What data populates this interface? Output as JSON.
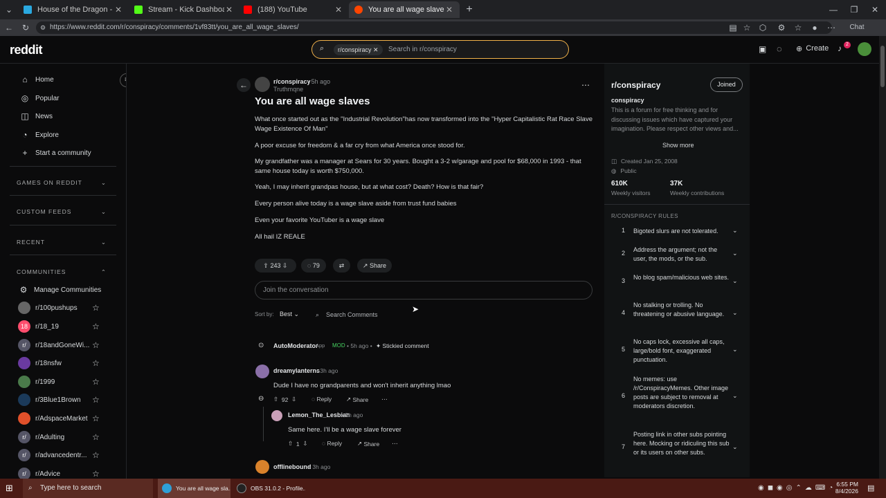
{
  "browser": {
    "tabs": [
      {
        "title": "House of the Dragon - Fmovies",
        "color": "#2aa9e0"
      },
      {
        "title": "Stream - Kick Dashboard",
        "color": "#53fc18"
      },
      {
        "title": "(188) YouTube",
        "color": "#ff0000"
      },
      {
        "title": "You are all wage slaves : r/conspi",
        "color": "#ff4500"
      }
    ],
    "url": "https://www.reddit.com/r/conspiracy/comments/1vf83tt/you_are_all_wage_slaves/",
    "chat_label": "Chat"
  },
  "reddit": {
    "logo": "reddit",
    "search_chip": "r/conspiracy",
    "search_placeholder": "Search in r/conspiracy",
    "create_label": "Create",
    "notif_count": "2"
  },
  "leftnav": {
    "items": [
      "Home",
      "Popular",
      "News",
      "Explore",
      "Start a community"
    ],
    "sections": [
      "GAMES ON REDDIT",
      "CUSTOM FEEDS",
      "RECENT",
      "COMMUNITIES"
    ],
    "manage": "Manage Communities",
    "communities": [
      "r/100pushups",
      "r/18_19",
      "r/18andGoneWi...",
      "r/18nsfw",
      "r/1999",
      "r/3Blue1Brown",
      "r/AdspaceMarket",
      "r/Adulting",
      "r/advancedentr...",
      "r/Advice"
    ]
  },
  "post": {
    "subreddit": "r/conspiracy",
    "age": "• 5h ago",
    "author": "Truthmqne",
    "title": "You are all wage slaves",
    "paragraphs": [
      "What once started out as the \"Industrial Revolution\"has now transformed into the \"Hyper Capitalistic Rat Race Slave Wage Existence Of Man\"",
      "A poor excuse for freedom & a far cry from what America once stood for.",
      "My grandfather was a manager at Sears for 30 years. Bought a 3-2 w/garage and pool for $68,000 in 1993 - that same house today is worth $750,000.",
      "Yeah, I may inherit grandpas house, but at what cost? Death? How is that fair?",
      "Every person alive today is a wage slave aside from trust fund babies",
      "Even your favorite YouTuber is a wage slave",
      "All hail IZ REALE"
    ],
    "votes": "243",
    "comments": "79",
    "share": "Share",
    "join_placeholder": "Join the conversation",
    "sort_label": "Sort by:",
    "sort_value": "Best",
    "search_comments": "Search Comments"
  },
  "comments": [
    {
      "user": "AutoModerator",
      "meta": "App",
      "mod": "MOD",
      "age": "• 5h ago •",
      "sticky": "Stickied comment"
    },
    {
      "user": "dreamylanterns",
      "age": "• 3h ago",
      "text": "Dude I have no grandparents and won't inherit anything lmao",
      "votes": "92",
      "reply": "Reply",
      "share": "Share"
    },
    {
      "user": "Lemon_The_Lesbian",
      "age": "• 2h ago",
      "text": "Same here. I'll be a wage slave forever",
      "votes": "1",
      "reply": "Reply",
      "share": "Share"
    },
    {
      "user": "offlinebound",
      "age": "• 3h ago"
    }
  ],
  "sidebar": {
    "name": "r/conspiracy",
    "joined": "Joined",
    "subtitle": "conspiracy",
    "description": "This is a forum for free thinking and for discussing issues which have captured your imagination. Please respect other views and...",
    "show_more": "Show more",
    "created": "Created Jan 25, 2008",
    "visibility": "Public",
    "visitors": "610K",
    "visitors_label": "Weekly visitors",
    "contribs": "37K",
    "contribs_label": "Weekly contributions",
    "rules_heading": "R/CONSPIRACY RULES",
    "rules": [
      "Bigoted slurs are not tolerated.",
      "Address the argument; not the user, the mods, or the sub.",
      "No blog spam/malicious web sites.",
      "No stalking or trolling. No threatening or abusive language.",
      "No caps lock, excessive all caps, large/bold font, exaggerated punctuation.",
      "No memes: use /r/ConspiracyMemes. Other image posts are subject to removal at moderators discretion.",
      "Posting link in other subs pointing here. Mocking or ridiculing this sub or its users on other subs."
    ]
  },
  "taskbar": {
    "search": "Type here to search",
    "apps": [
      "You are all wage sla...",
      "OBS 31.0.2 - Profile..."
    ],
    "time": "6:55 PM",
    "date": "8/4/2026"
  }
}
